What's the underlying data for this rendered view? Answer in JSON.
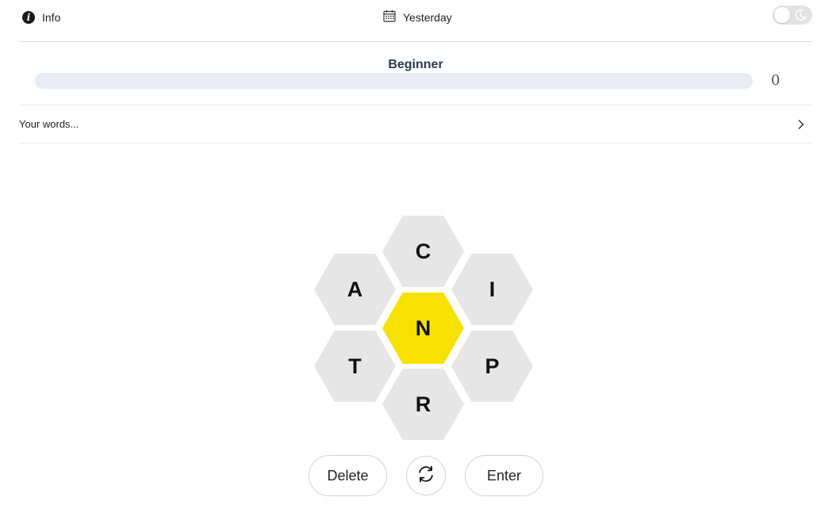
{
  "header": {
    "info_label": "Info",
    "info_icon": "info-icon",
    "date_label": "Yesterday",
    "date_icon": "calendar-icon",
    "theme_toggle_icon": "moon-icon",
    "theme_dark_mode": false
  },
  "progress": {
    "rank": "Beginner",
    "score": "0",
    "fraction": 0,
    "track_color": "#e9ecf4",
    "fill_color": "#f7da21"
  },
  "words": {
    "placeholder": "Your words...",
    "expand_icon": "chevron-right-icon"
  },
  "hive": {
    "center": "N",
    "top": "C",
    "upper_left": "A",
    "upper_right": "I",
    "lower_left": "T",
    "lower_right": "P",
    "bottom": "R",
    "center_color": "#f7e100",
    "outer_color": "#e6e6e6"
  },
  "controls": {
    "delete_label": "Delete",
    "shuffle_icon": "shuffle-icon",
    "enter_label": "Enter"
  }
}
